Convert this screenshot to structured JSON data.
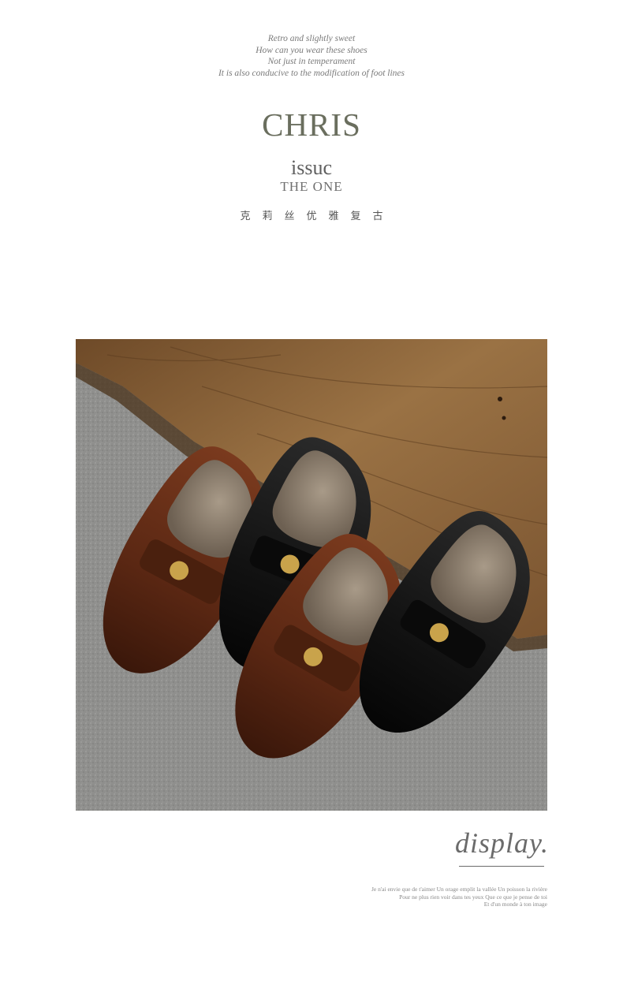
{
  "intro": {
    "lines": [
      "Retro and slightly sweet",
      "How can you wear these shoes",
      "Not just in temperament",
      "It is also conducive to the modification of foot lines"
    ]
  },
  "brand": {
    "name": "CHRIS"
  },
  "issue": {
    "title": "issuc",
    "subtitle": "THE ONE"
  },
  "tagline_cn": "克莉丝优雅复古",
  "photo": {
    "subject": "four penny loafers (two brown, two black) with gold coin ornaments on grey carpet against wooden step",
    "colors": {
      "carpet": "#8e8e8c",
      "wood": "#8a6238",
      "brown_leather": "#5a2a17",
      "black_leather": "#141414",
      "gold": "#c9a34b"
    }
  },
  "display": {
    "word": "display."
  },
  "poem": {
    "lines": [
      "Je n'ai envie que de t'aimer Un orage emplit la vallée Un poisson la rivière",
      "Pour ne plus rien voir dans tes yeux Que ce que je pense de toi",
      "Et d'un monde à ton image"
    ]
  }
}
